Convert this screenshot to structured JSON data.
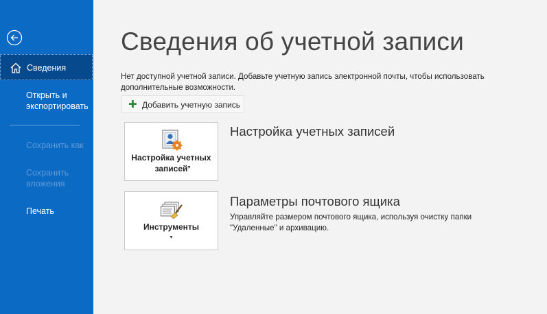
{
  "sidebar": {
    "back_icon": "back-arrow-icon",
    "items": [
      {
        "label": "Сведения",
        "active": true
      },
      {
        "label": "Открыть и экспортировать"
      },
      {
        "label": "Сохранить как",
        "disabled": true
      },
      {
        "label": "Сохранить вложения",
        "disabled": true
      },
      {
        "label": "Печать"
      }
    ]
  },
  "main": {
    "title": "Сведения об учетной записи",
    "info_text": "Нет доступной учетной записи. Добавьте учетную запись электронной почты, чтобы использовать дополнительные возможности.",
    "add_account_label": "Добавить учетную запись",
    "sections": [
      {
        "tile_label": "Настройка учетных записей",
        "title": "Настройка учетных записей",
        "description": ""
      },
      {
        "tile_label": "Инструменты",
        "title": "Параметры почтового ящика",
        "description": "Управляйте размером почтового ящика, используя очистку папки \"Удаленные\" и архивацию."
      }
    ]
  },
  "colors": {
    "sidebar_bg": "#0b6ac4",
    "sidebar_active": "#064a8d",
    "accent_orange": "#e8821e",
    "plus_green": "#2e8b3a"
  }
}
